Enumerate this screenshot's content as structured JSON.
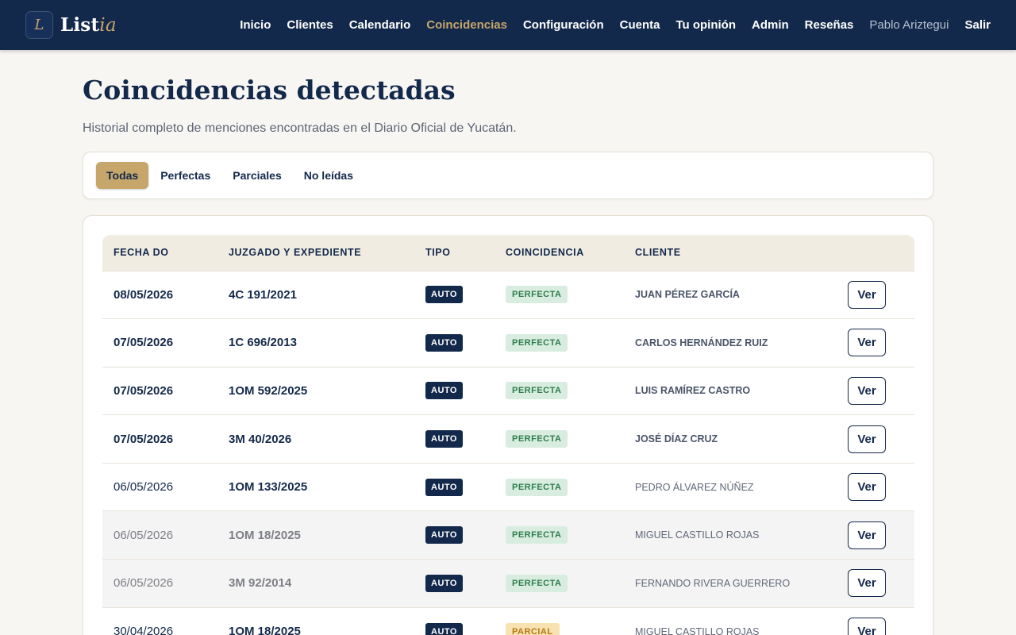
{
  "brand": {
    "letter": "L",
    "name_main": "List",
    "name_accent": "ia"
  },
  "nav": {
    "items": [
      "Inicio",
      "Clientes",
      "Calendario",
      "Coincidencias",
      "Configuración",
      "Cuenta",
      "Tu opinión",
      "Admin",
      "Reseñas"
    ],
    "active": "Coincidencias",
    "user": "Pablo Ariztegui",
    "logout": "Salir"
  },
  "header": {
    "title": "Coincidencias detectadas",
    "subtitle": "Historial completo de menciones encontradas en el Diario Oficial de Yucatán."
  },
  "filters": {
    "items": [
      "Todas",
      "Perfectas",
      "Parciales",
      "No leídas"
    ],
    "active": "Todas"
  },
  "table": {
    "columns": [
      "FECHA DO",
      "JUZGADO Y EXPEDIENTE",
      "TIPO",
      "COINCIDENCIA",
      "CLIENTE",
      ""
    ],
    "view_label": "Ver",
    "rows": [
      {
        "date": "08/05/2026",
        "expediente": "4C 191/2021",
        "tipo": "AUTO",
        "coincidencia": "PERFECTA",
        "cliente": "JUAN PÉREZ GARCÍA"
      },
      {
        "date": "07/05/2026",
        "expediente": "1C 696/2013",
        "tipo": "AUTO",
        "coincidencia": "PERFECTA",
        "cliente": "CARLOS HERNÁNDEZ RUIZ"
      },
      {
        "date": "07/05/2026",
        "expediente": "1OM 592/2025",
        "tipo": "AUTO",
        "coincidencia": "PERFECTA",
        "cliente": "LUIS RAMÍREZ CASTRO"
      },
      {
        "date": "07/05/2026",
        "expediente": "3M 40/2026",
        "tipo": "AUTO",
        "coincidencia": "PERFECTA",
        "cliente": "JOSÉ DÍAZ CRUZ"
      },
      {
        "date": "06/05/2026",
        "expediente": "1OM 133/2025",
        "tipo": "AUTO",
        "coincidencia": "PERFECTA",
        "cliente": "PEDRO ÁLVAREZ NÚÑEZ"
      },
      {
        "date": "06/05/2026",
        "expediente": "1OM 18/2025",
        "tipo": "AUTO",
        "coincidencia": "PERFECTA",
        "cliente": "MIGUEL CASTILLO ROJAS"
      },
      {
        "date": "06/05/2026",
        "expediente": "3M 92/2014",
        "tipo": "AUTO",
        "coincidencia": "PERFECTA",
        "cliente": "FERNANDO RIVERA GUERRERO"
      },
      {
        "date": "30/04/2026",
        "expediente": "1OM 18/2025",
        "tipo": "AUTO",
        "coincidencia": "PARCIAL",
        "cliente": "MIGUEL CASTILLO ROJAS"
      }
    ]
  },
  "colors": {
    "navy": "#13294b",
    "gold": "#c6a66b",
    "background": "#f8f6f2",
    "perfecta": "#2f7d4d",
    "parcial": "#b47a16"
  }
}
